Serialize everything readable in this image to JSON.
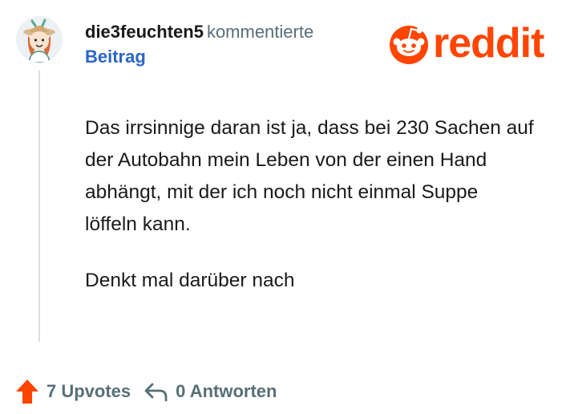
{
  "comment": {
    "username": "die3feuchten5",
    "action": "kommentierte",
    "post_link": "Beitrag",
    "paragraphs": [
      "Das irrsinnige daran ist ja, dass bei 230 Sachen auf der Autobahn mein Leben von der einen Hand abhängt, mit der ich noch nicht einmal Suppe löffeln kann.",
      "Denkt mal darüber nach"
    ]
  },
  "brand": {
    "wordmark": "reddit",
    "color": "#ff4500",
    "icon": "reddit-snoo-icon"
  },
  "footer": {
    "upvotes_label": "7 Upvotes",
    "replies_label": "0 Antworten",
    "upvote_icon": "upvote-arrow-icon",
    "reply_icon": "reply-arrow-icon",
    "upvote_color": "#ff4500"
  },
  "colors": {
    "link": "#2d65c8",
    "meta": "#576f76",
    "text": "#1a1a1b"
  }
}
